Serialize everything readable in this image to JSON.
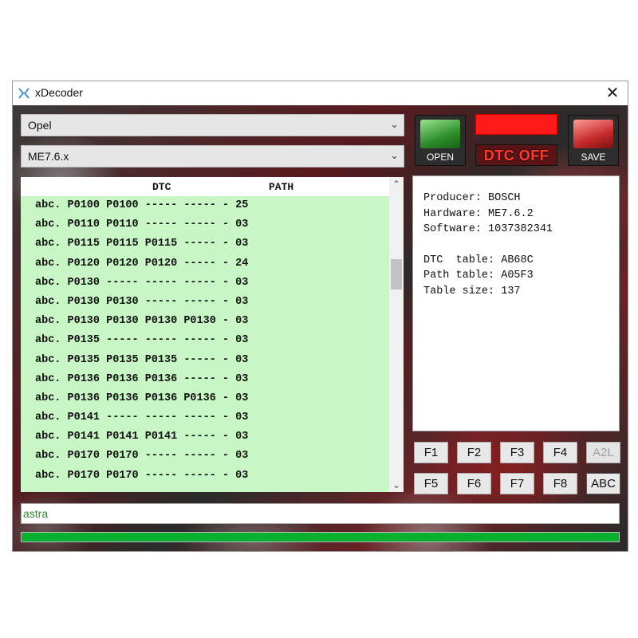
{
  "window": {
    "title": "xDecoder",
    "close_symbol": "✕"
  },
  "make_select": {
    "value": "Opel"
  },
  "ecu_select": {
    "value": "ME7.6.x"
  },
  "toolbar": {
    "open_label": "OPEN",
    "save_label": "SAVE",
    "dtc_off_label": "DTC OFF",
    "indicator_color": "#ff1a1a"
  },
  "dtc_list": {
    "columns": [
      "DTC",
      "PATH"
    ],
    "rows": [
      "abc. P0100 P0100 ----- ----- - 25",
      "abc. P0110 P0110 ----- ----- - 03",
      "abc. P0115 P0115 P0115 ----- - 03",
      "abc. P0120 P0120 P0120 ----- - 24",
      "abc. P0130 ----- ----- ----- - 03",
      "abc. P0130 P0130 ----- ----- - 03",
      "abc. P0130 P0130 P0130 P0130 - 03",
      "abc. P0135 ----- ----- ----- - 03",
      "abc. P0135 P0135 P0135 ----- - 03",
      "abc. P0136 P0136 P0136 ----- - 03",
      "abc. P0136 P0136 P0136 P0136 - 03",
      "abc. P0141 ----- ----- ----- - 03",
      "abc. P0141 P0141 P0141 ----- - 03",
      "abc. P0170 P0170 ----- ----- - 03",
      "abc. P0170 P0170 ----- ----- - 03"
    ],
    "row_bg": "#c8f7c5"
  },
  "info": {
    "producer": "Producer: BOSCH",
    "hardware": "Hardware: ME7.6.2",
    "software": "Software: 1037382341",
    "dtc_table": "DTC  table: AB68C",
    "path_table": "Path table: A05F3",
    "table_size": "Table size: 137"
  },
  "function_buttons": {
    "f1": "F1",
    "f2": "F2",
    "f3": "F3",
    "f4": "F4",
    "a2l": "A2L",
    "f5": "F5",
    "f6": "F6",
    "f7": "F7",
    "f8": "F8",
    "abc": "ABC"
  },
  "search": {
    "value": "astra"
  },
  "progress": {
    "fraction": 1.0,
    "color": "#07b12f"
  },
  "icons": {
    "app": "xdecoder-app-icon",
    "close": "close-icon",
    "dropdown": "chevron-down-icon",
    "open": "open-folder-icon",
    "save": "save-disk-icon"
  }
}
